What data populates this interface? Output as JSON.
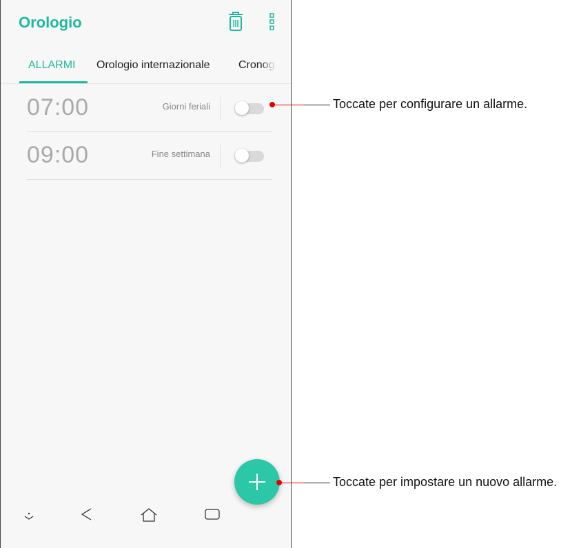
{
  "app": {
    "title": "Orologio"
  },
  "toolbar": {
    "delete_icon": "trash-icon",
    "more_icon": "more-vert-icon"
  },
  "tabs": [
    {
      "label": "ALLARMI",
      "selected": true
    },
    {
      "label": "Orologio internazionale",
      "selected": false
    },
    {
      "label": "Cronog",
      "selected": false
    }
  ],
  "alarms": [
    {
      "time": "07:00",
      "repeat": "Giorni feriali",
      "enabled": false
    },
    {
      "time": "09:00",
      "repeat": "Fine settimana",
      "enabled": false
    }
  ],
  "fab": {
    "icon": "plus-icon"
  },
  "navbar": {
    "icons": [
      "keyboard-hide-icon",
      "back-icon",
      "home-icon",
      "recents-icon"
    ]
  },
  "callouts": {
    "toggle": "Toccate per configurare un allarme.",
    "add": "Toccate per impostare un nuovo allarme."
  },
  "colors": {
    "accent": "#1fb89e",
    "fab": "#2bc7a6",
    "callout_marker": "#e00000"
  }
}
